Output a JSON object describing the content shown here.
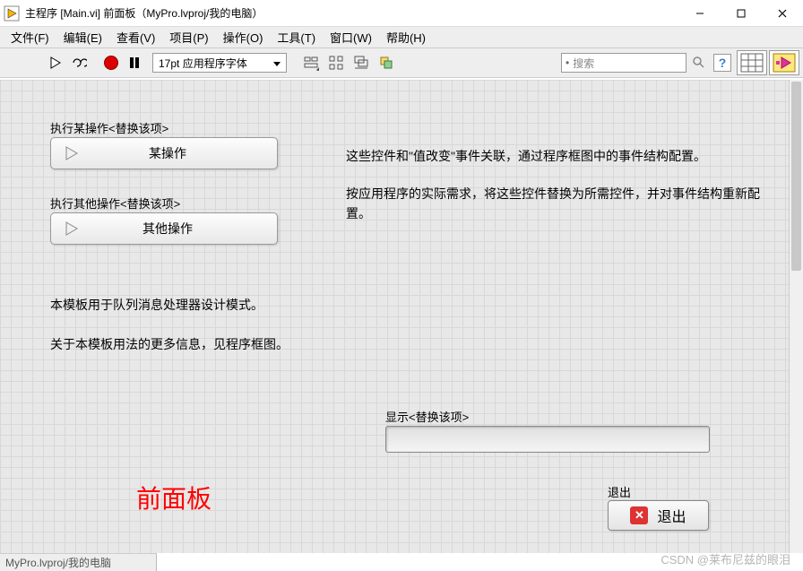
{
  "window": {
    "title": "主程序 [Main.vi] 前面板（MyPro.lvproj/我的电脑）"
  },
  "menu": {
    "file": "文件(F)",
    "edit": "编辑(E)",
    "view": "查看(V)",
    "project": "项目(P)",
    "operate": "操作(O)",
    "tools": "工具(T)",
    "window": "窗口(W)",
    "help": "帮助(H)"
  },
  "toolbar": {
    "font": "17pt 应用程序字体",
    "search_placeholder": "搜索",
    "help": "?"
  },
  "panel": {
    "label1": "执行某操作<替换该项>",
    "btn1": "某操作",
    "label2": "执行其他操作<替换该项>",
    "btn2": "其他操作",
    "info1": "这些控件和\"值改变\"事件关联，通过程序框图中的事件结构配置。",
    "info2": "按应用程序的实际需求，将这些控件替换为所需控件，并对事件结构重新配置。",
    "info3": "本模板用于队列消息处理器设计模式。",
    "info4": "关于本模板用法的更多信息，见程序框图。",
    "display_label": "显示<替换该项>",
    "display_value": "",
    "exit_label": "退出",
    "exit_btn": "退出",
    "annotation": "前面板"
  },
  "footer": {
    "project": "MyPro.lvproj/我的电脑",
    "watermark": "CSDN @莱布尼兹的眼泪"
  }
}
